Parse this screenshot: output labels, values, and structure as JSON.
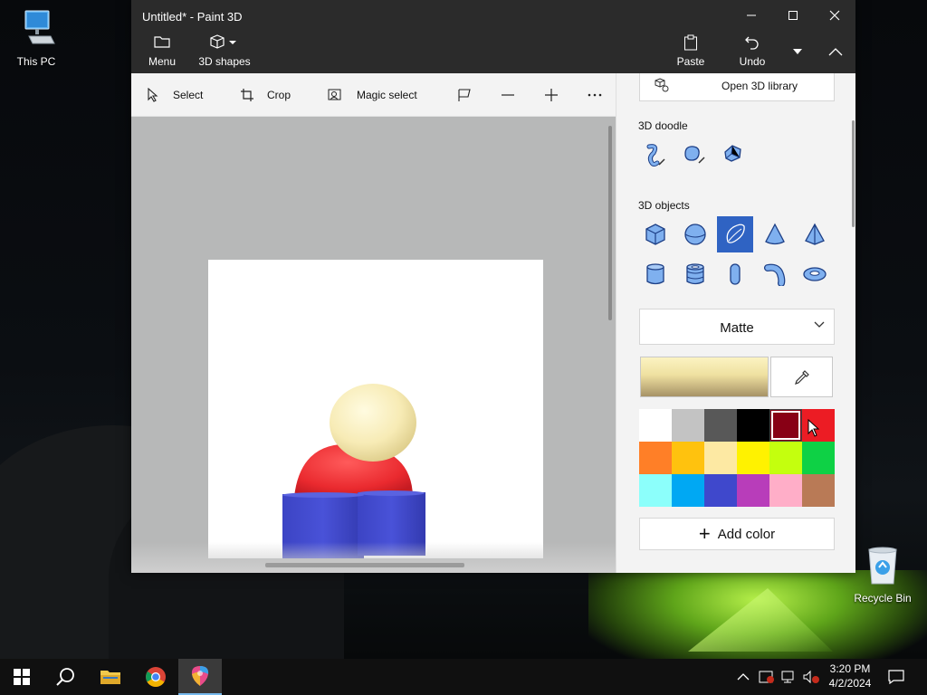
{
  "desktop": {
    "icons": [
      {
        "label": "This PC",
        "icon": "computer-icon"
      },
      {
        "label": "Recycle Bin",
        "icon": "recycle-bin-icon"
      }
    ]
  },
  "window": {
    "title": "Untitled* - Paint 3D",
    "ribbon": {
      "menu_label": "Menu",
      "shapes_label": "3D shapes",
      "paste_label": "Paste",
      "undo_label": "Undo"
    },
    "toolbar": {
      "select_label": "Select",
      "crop_label": "Crop",
      "magic_select_label": "Magic select"
    },
    "panel": {
      "library_label": "Open 3D library",
      "doodle_heading": "3D doodle",
      "doodle_tools": [
        "sharp-edge-doodle-icon",
        "soft-edge-doodle-icon",
        "tube-doodle-icon"
      ],
      "objects_heading": "3D objects",
      "objects": [
        "cube-icon",
        "sphere-icon",
        "egg-icon",
        "cone-icon",
        "pyramid-icon",
        "cylinder-icon",
        "tube-icon",
        "capsule-icon",
        "curved-tube-icon",
        "donut-icon"
      ],
      "selected_object": "egg-icon",
      "material": "Matte",
      "current_color": "#efe0a0",
      "palette": [
        "#ffffff",
        "#c3c3c3",
        "#585858",
        "#000000",
        "#880015",
        "#ec1c24",
        "#ff7f27",
        "#ffc20e",
        "#fde9a3",
        "#fff200",
        "#c4ff0e",
        "#0ed145",
        "#8cfffb",
        "#00a8f3",
        "#3f48cc",
        "#b83dba",
        "#ffaec8",
        "#b97a56"
      ],
      "selected_swatch": "#880015",
      "add_color_label": "Add color"
    }
  },
  "taskbar": {
    "time": "3:20 PM",
    "date": "4/2/2024",
    "apps": [
      "start-icon",
      "search-icon",
      "file-explorer-icon",
      "chrome-icon",
      "paint3d-icon"
    ],
    "active_app": "paint3d-icon"
  }
}
